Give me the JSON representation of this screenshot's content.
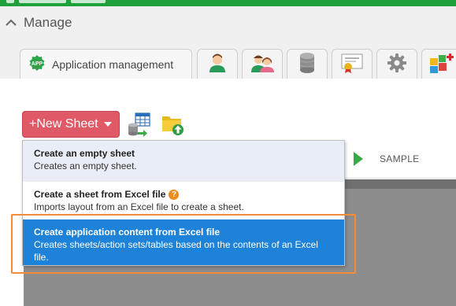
{
  "section": {
    "title": "Manage",
    "caret_icon": "chevron-up-icon"
  },
  "tabs": [
    {
      "label": "Application management",
      "icon": "app-badge-icon",
      "badge_text": "APP",
      "active": true
    },
    {
      "label": "",
      "icon": "user-icon"
    },
    {
      "label": "",
      "icon": "users-icon"
    },
    {
      "label": "",
      "icon": "database-icon"
    },
    {
      "label": "",
      "icon": "certificate-icon"
    },
    {
      "label": "",
      "icon": "gear-icon"
    },
    {
      "label": "",
      "icon": "blocks-add-icon"
    }
  ],
  "toolbar": {
    "new_sheet_label": "+New Sheet",
    "table_icon": "table-database-icon",
    "folder_icon": "folder-upload-icon"
  },
  "menu": {
    "items": [
      {
        "title": "Create an empty sheet",
        "description": "Creates an empty sheet.",
        "state": "hover"
      },
      {
        "title": "Create a sheet from Excel file",
        "description": "Imports layout from an Excel file to create a sheet.",
        "help_icon": "help-icon",
        "help_text": "?"
      },
      {
        "title": "Create application content from Excel file",
        "description": "Creates sheets/action sets/tables based on the contents of an Excel file.",
        "state": "selected"
      }
    ]
  },
  "background": {
    "sample_label": "SAMPLE",
    "play_icon": "play-icon"
  },
  "colors": {
    "top_bar": "#1ea03a",
    "new_sheet_button": "#e05967",
    "selected_item": "#1e83d8",
    "hover_item": "#e9edf5",
    "highlight_box": "#f08c3a",
    "play": "#3aaa48"
  }
}
